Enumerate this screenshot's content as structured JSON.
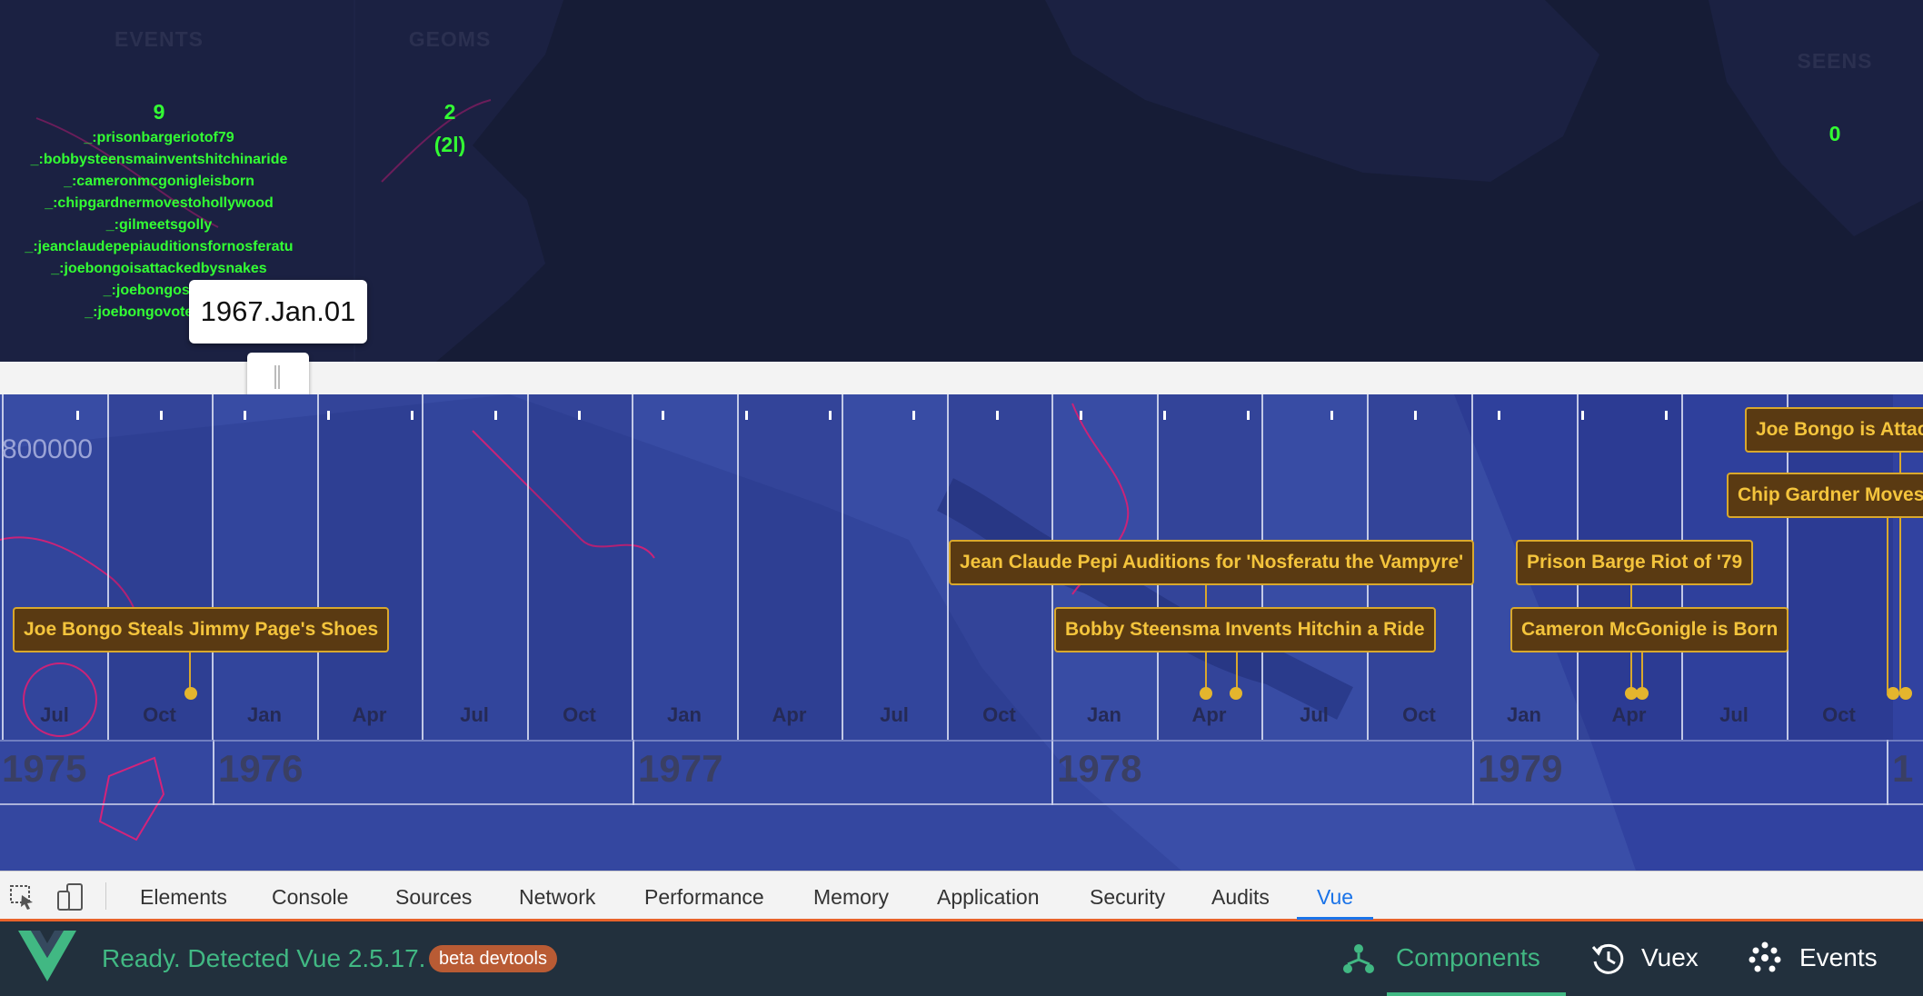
{
  "stats": {
    "events_heading": "EVENTS",
    "events_count": "9",
    "geoms_heading": "GEOMS",
    "geoms_count": "2",
    "geoms_sub": "(2l)",
    "seens_heading": "SEENS",
    "seens_count": "0",
    "event_ids": [
      "_:prisonbargeriotof79",
      "_:bobbysteensmainventshitchinaride",
      "_:cameronmcgonigleisborn",
      "_:chipgardnermovestohollywood",
      "_:gilmeetsgolly",
      "_:jeanclaudepepiauditionsfornosferatu",
      "_:joebongoisattackedbysnakes",
      "_:joebongosteal",
      "_:joebongovotesforjo"
    ]
  },
  "slider": {
    "date": "1967.Jan.01"
  },
  "timeline": {
    "big_number": "800000",
    "months": [
      "Jul",
      "Oct",
      "Jan",
      "Apr",
      "Jul",
      "Oct",
      "Jan",
      "Apr",
      "Jul",
      "Oct",
      "Jan",
      "Apr",
      "Jul",
      "Oct",
      "Jan",
      "Apr",
      "Jul",
      "Oct"
    ],
    "years": [
      "1975",
      "1976",
      "1977",
      "1978",
      "1979",
      "1"
    ],
    "events": [
      {
        "label": "Joe Bongo Steals Jimmy Page's Shoes"
      },
      {
        "label": "Jean Claude Pepi Auditions for 'Nosferatu the Vampyre'"
      },
      {
        "label": "Bobby Steensma Invents Hitchin a Ride"
      },
      {
        "label": "Prison Barge Riot of '79"
      },
      {
        "label": "Cameron McGonigle is Born"
      },
      {
        "label": "Joe Bongo is Attac"
      },
      {
        "label": "Chip Gardner Moves"
      }
    ]
  },
  "devtools": {
    "tabs": [
      "Elements",
      "Console",
      "Sources",
      "Network",
      "Performance",
      "Memory",
      "Application",
      "Security",
      "Audits",
      "Vue"
    ],
    "active_tab": "Vue"
  },
  "vue": {
    "status": "Ready. Detected Vue 2.5.17.",
    "badge": "beta devtools",
    "nav": [
      "Components",
      "Vuex",
      "Events"
    ],
    "accent": "#41b883"
  }
}
